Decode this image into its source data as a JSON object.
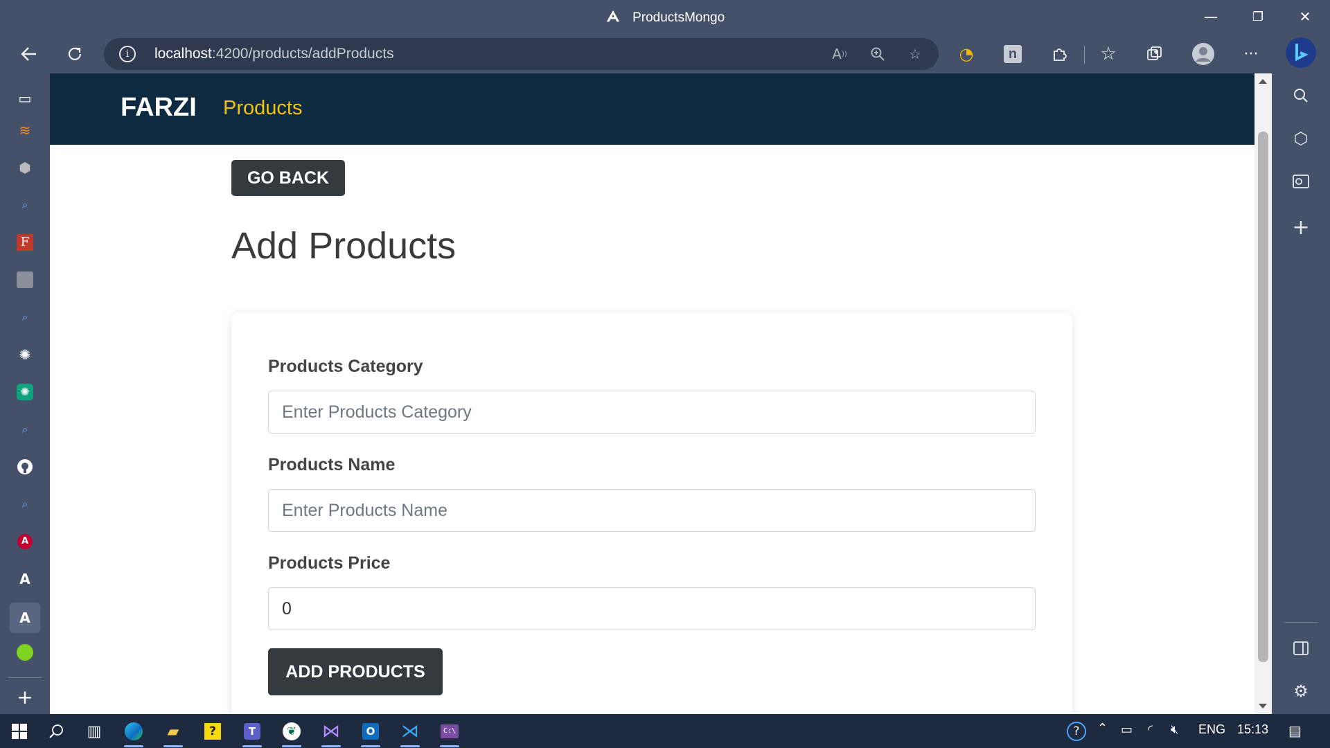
{
  "window": {
    "title": "ProductsMongo",
    "controls": {
      "minimize": "—",
      "restore": "❐",
      "close": "✕"
    }
  },
  "browser": {
    "url_host": "localhost",
    "url_path": ":4200/products/addProducts",
    "toolbar_icons": [
      "back-icon",
      "refresh-icon",
      "info-icon",
      "read-aloud-icon",
      "zoom-icon",
      "favorite-add-icon",
      "extension-icon",
      "notion-icon",
      "puzzle-icon",
      "favorites-icon",
      "collections-icon",
      "profile-icon",
      "more-icon",
      "bing-icon"
    ]
  },
  "app": {
    "brand": "FARZI",
    "nav_link": "Products"
  },
  "page": {
    "go_back_label": "GO BACK",
    "title": "Add Products"
  },
  "form": {
    "category_label": "Products Category",
    "category_placeholder": "Enter Products Category",
    "name_label": "Products Name",
    "name_placeholder": "Enter Products Name",
    "price_label": "Products Price",
    "price_value": "0",
    "submit_label": "ADD PRODUCTS"
  },
  "taskbar": {
    "language": "ENG",
    "time": "15:13"
  },
  "colors": {
    "navbar": "#0d2a40",
    "brand_accent": "#f4c20d",
    "button_dark": "#343a40",
    "chrome": "#455069",
    "taskbar": "#1d2a40"
  }
}
